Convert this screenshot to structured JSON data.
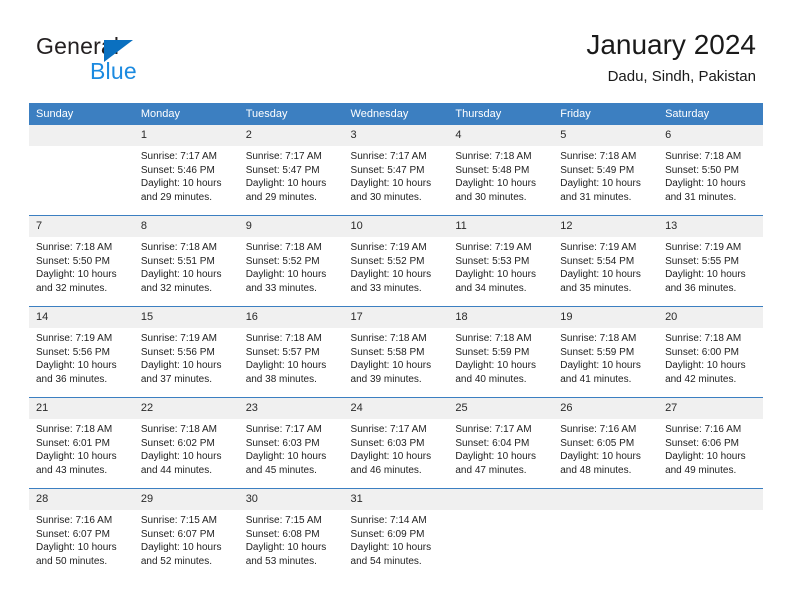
{
  "brand": {
    "name_part1": "General",
    "name_part2": "Blue",
    "accent_color": "#1b8ae0",
    "triangle_color": "#0a70c0"
  },
  "header": {
    "title": "January 2024",
    "subtitle": "Dadu, Sindh, Pakistan"
  },
  "calendar": {
    "header_bg": "#3c7fc1",
    "daynum_bg": "#f0f0f0",
    "weekday_headers": [
      "Sunday",
      "Monday",
      "Tuesday",
      "Wednesday",
      "Thursday",
      "Friday",
      "Saturday"
    ],
    "weeks": [
      [
        {
          "day": "",
          "sunrise": "",
          "sunset": "",
          "daylight_line1": "",
          "daylight_line2": ""
        },
        {
          "day": "1",
          "sunrise": "Sunrise: 7:17 AM",
          "sunset": "Sunset: 5:46 PM",
          "daylight_line1": "Daylight: 10 hours",
          "daylight_line2": "and 29 minutes."
        },
        {
          "day": "2",
          "sunrise": "Sunrise: 7:17 AM",
          "sunset": "Sunset: 5:47 PM",
          "daylight_line1": "Daylight: 10 hours",
          "daylight_line2": "and 29 minutes."
        },
        {
          "day": "3",
          "sunrise": "Sunrise: 7:17 AM",
          "sunset": "Sunset: 5:47 PM",
          "daylight_line1": "Daylight: 10 hours",
          "daylight_line2": "and 30 minutes."
        },
        {
          "day": "4",
          "sunrise": "Sunrise: 7:18 AM",
          "sunset": "Sunset: 5:48 PM",
          "daylight_line1": "Daylight: 10 hours",
          "daylight_line2": "and 30 minutes."
        },
        {
          "day": "5",
          "sunrise": "Sunrise: 7:18 AM",
          "sunset": "Sunset: 5:49 PM",
          "daylight_line1": "Daylight: 10 hours",
          "daylight_line2": "and 31 minutes."
        },
        {
          "day": "6",
          "sunrise": "Sunrise: 7:18 AM",
          "sunset": "Sunset: 5:50 PM",
          "daylight_line1": "Daylight: 10 hours",
          "daylight_line2": "and 31 minutes."
        }
      ],
      [
        {
          "day": "7",
          "sunrise": "Sunrise: 7:18 AM",
          "sunset": "Sunset: 5:50 PM",
          "daylight_line1": "Daylight: 10 hours",
          "daylight_line2": "and 32 minutes."
        },
        {
          "day": "8",
          "sunrise": "Sunrise: 7:18 AM",
          "sunset": "Sunset: 5:51 PM",
          "daylight_line1": "Daylight: 10 hours",
          "daylight_line2": "and 32 minutes."
        },
        {
          "day": "9",
          "sunrise": "Sunrise: 7:18 AM",
          "sunset": "Sunset: 5:52 PM",
          "daylight_line1": "Daylight: 10 hours",
          "daylight_line2": "and 33 minutes."
        },
        {
          "day": "10",
          "sunrise": "Sunrise: 7:19 AM",
          "sunset": "Sunset: 5:52 PM",
          "daylight_line1": "Daylight: 10 hours",
          "daylight_line2": "and 33 minutes."
        },
        {
          "day": "11",
          "sunrise": "Sunrise: 7:19 AM",
          "sunset": "Sunset: 5:53 PM",
          "daylight_line1": "Daylight: 10 hours",
          "daylight_line2": "and 34 minutes."
        },
        {
          "day": "12",
          "sunrise": "Sunrise: 7:19 AM",
          "sunset": "Sunset: 5:54 PM",
          "daylight_line1": "Daylight: 10 hours",
          "daylight_line2": "and 35 minutes."
        },
        {
          "day": "13",
          "sunrise": "Sunrise: 7:19 AM",
          "sunset": "Sunset: 5:55 PM",
          "daylight_line1": "Daylight: 10 hours",
          "daylight_line2": "and 36 minutes."
        }
      ],
      [
        {
          "day": "14",
          "sunrise": "Sunrise: 7:19 AM",
          "sunset": "Sunset: 5:56 PM",
          "daylight_line1": "Daylight: 10 hours",
          "daylight_line2": "and 36 minutes."
        },
        {
          "day": "15",
          "sunrise": "Sunrise: 7:19 AM",
          "sunset": "Sunset: 5:56 PM",
          "daylight_line1": "Daylight: 10 hours",
          "daylight_line2": "and 37 minutes."
        },
        {
          "day": "16",
          "sunrise": "Sunrise: 7:18 AM",
          "sunset": "Sunset: 5:57 PM",
          "daylight_line1": "Daylight: 10 hours",
          "daylight_line2": "and 38 minutes."
        },
        {
          "day": "17",
          "sunrise": "Sunrise: 7:18 AM",
          "sunset": "Sunset: 5:58 PM",
          "daylight_line1": "Daylight: 10 hours",
          "daylight_line2": "and 39 minutes."
        },
        {
          "day": "18",
          "sunrise": "Sunrise: 7:18 AM",
          "sunset": "Sunset: 5:59 PM",
          "daylight_line1": "Daylight: 10 hours",
          "daylight_line2": "and 40 minutes."
        },
        {
          "day": "19",
          "sunrise": "Sunrise: 7:18 AM",
          "sunset": "Sunset: 5:59 PM",
          "daylight_line1": "Daylight: 10 hours",
          "daylight_line2": "and 41 minutes."
        },
        {
          "day": "20",
          "sunrise": "Sunrise: 7:18 AM",
          "sunset": "Sunset: 6:00 PM",
          "daylight_line1": "Daylight: 10 hours",
          "daylight_line2": "and 42 minutes."
        }
      ],
      [
        {
          "day": "21",
          "sunrise": "Sunrise: 7:18 AM",
          "sunset": "Sunset: 6:01 PM",
          "daylight_line1": "Daylight: 10 hours",
          "daylight_line2": "and 43 minutes."
        },
        {
          "day": "22",
          "sunrise": "Sunrise: 7:18 AM",
          "sunset": "Sunset: 6:02 PM",
          "daylight_line1": "Daylight: 10 hours",
          "daylight_line2": "and 44 minutes."
        },
        {
          "day": "23",
          "sunrise": "Sunrise: 7:17 AM",
          "sunset": "Sunset: 6:03 PM",
          "daylight_line1": "Daylight: 10 hours",
          "daylight_line2": "and 45 minutes."
        },
        {
          "day": "24",
          "sunrise": "Sunrise: 7:17 AM",
          "sunset": "Sunset: 6:03 PM",
          "daylight_line1": "Daylight: 10 hours",
          "daylight_line2": "and 46 minutes."
        },
        {
          "day": "25",
          "sunrise": "Sunrise: 7:17 AM",
          "sunset": "Sunset: 6:04 PM",
          "daylight_line1": "Daylight: 10 hours",
          "daylight_line2": "and 47 minutes."
        },
        {
          "day": "26",
          "sunrise": "Sunrise: 7:16 AM",
          "sunset": "Sunset: 6:05 PM",
          "daylight_line1": "Daylight: 10 hours",
          "daylight_line2": "and 48 minutes."
        },
        {
          "day": "27",
          "sunrise": "Sunrise: 7:16 AM",
          "sunset": "Sunset: 6:06 PM",
          "daylight_line1": "Daylight: 10 hours",
          "daylight_line2": "and 49 minutes."
        }
      ],
      [
        {
          "day": "28",
          "sunrise": "Sunrise: 7:16 AM",
          "sunset": "Sunset: 6:07 PM",
          "daylight_line1": "Daylight: 10 hours",
          "daylight_line2": "and 50 minutes."
        },
        {
          "day": "29",
          "sunrise": "Sunrise: 7:15 AM",
          "sunset": "Sunset: 6:07 PM",
          "daylight_line1": "Daylight: 10 hours",
          "daylight_line2": "and 52 minutes."
        },
        {
          "day": "30",
          "sunrise": "Sunrise: 7:15 AM",
          "sunset": "Sunset: 6:08 PM",
          "daylight_line1": "Daylight: 10 hours",
          "daylight_line2": "and 53 minutes."
        },
        {
          "day": "31",
          "sunrise": "Sunrise: 7:14 AM",
          "sunset": "Sunset: 6:09 PM",
          "daylight_line1": "Daylight: 10 hours",
          "daylight_line2": "and 54 minutes."
        },
        {
          "day": "",
          "sunrise": "",
          "sunset": "",
          "daylight_line1": "",
          "daylight_line2": ""
        },
        {
          "day": "",
          "sunrise": "",
          "sunset": "",
          "daylight_line1": "",
          "daylight_line2": ""
        },
        {
          "day": "",
          "sunrise": "",
          "sunset": "",
          "daylight_line1": "",
          "daylight_line2": ""
        }
      ]
    ]
  }
}
